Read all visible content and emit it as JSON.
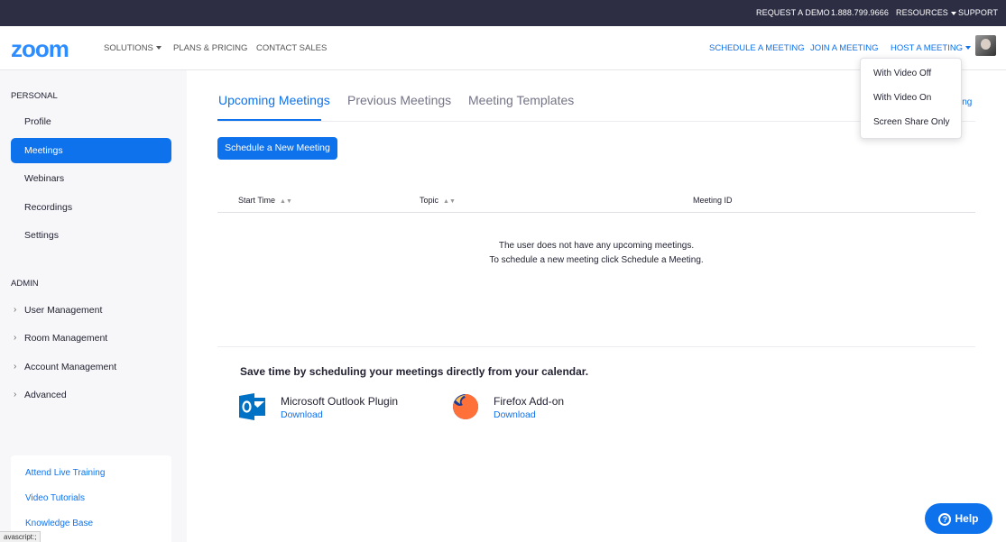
{
  "topbar": {
    "request_demo": "REQUEST A DEMO",
    "phone": "1.888.799.9666",
    "resources": "RESOURCES",
    "support": "SUPPORT"
  },
  "header": {
    "logo": "zoom",
    "nav": {
      "solutions": "SOLUTIONS",
      "plans_pricing": "PLANS & PRICING",
      "contact_sales": "CONTACT SALES"
    },
    "right": {
      "schedule": "SCHEDULE A MEETING",
      "join": "JOIN A MEETING",
      "host": "HOST A MEETING"
    }
  },
  "host_dropdown": {
    "items": [
      "With Video Off",
      "With Video On",
      "Screen Share Only"
    ]
  },
  "sidebar": {
    "personal_label": "PERSONAL",
    "personal_items": [
      "Profile",
      "Meetings",
      "Webinars",
      "Recordings",
      "Settings"
    ],
    "active_item": "Meetings",
    "admin_label": "ADMIN",
    "admin_items": [
      "User Management",
      "Room Management",
      "Account Management",
      "Advanced"
    ],
    "links": [
      "Attend Live Training",
      "Video Tutorials",
      "Knowledge Base"
    ]
  },
  "main": {
    "tabs": [
      "Upcoming Meetings",
      "Previous Meetings",
      "Meeting Templates"
    ],
    "partial_link": "ing",
    "schedule_button": "Schedule a New Meeting",
    "table_headers": [
      "Start Time",
      "Topic",
      "Meeting ID"
    ],
    "empty_line1": "The user does not have any upcoming meetings.",
    "empty_line2": "To schedule a new meeting click Schedule a Meeting.",
    "calendar_title": "Save time by scheduling your meetings directly from your calendar.",
    "plugins": [
      {
        "name": "Microsoft Outlook Plugin",
        "action": "Download"
      },
      {
        "name": "Firefox Add-on",
        "action": "Download"
      }
    ]
  },
  "help_button": "Help",
  "status_bar": "avascript:;",
  "colors": {
    "brand": "#2d8cff",
    "accent": "#0e72ed",
    "topbar": "#2d2e43"
  }
}
